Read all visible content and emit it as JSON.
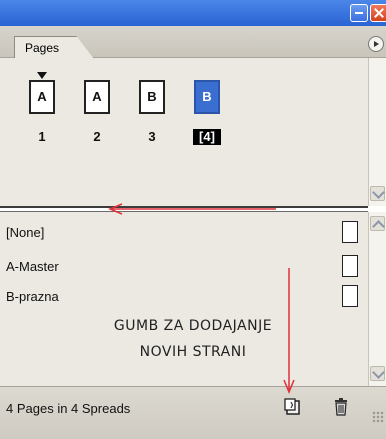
{
  "panel": {
    "tab_label": "Pages"
  },
  "pages": [
    {
      "letter": "A",
      "number": "1",
      "selected": false
    },
    {
      "letter": "A",
      "number": "2",
      "selected": false
    },
    {
      "letter": "B",
      "number": "3",
      "selected": false
    },
    {
      "letter": "B",
      "number": "[4]",
      "selected": true
    }
  ],
  "masters": [
    {
      "label": "[None]"
    },
    {
      "label": "A-Master"
    },
    {
      "label": "B-prazna"
    }
  ],
  "annotation": {
    "line1": "GUMB ZA DODAJANJE",
    "line2": "NOVIH STRANI"
  },
  "status": {
    "text": "4 Pages in 4 Spreads"
  },
  "icons": {
    "new_page": "new-page-icon",
    "delete": "trash-icon"
  },
  "colors": {
    "arrow": "#e0303a",
    "selected_page": "#3a6fd1",
    "titlebar": "#2a63d3"
  }
}
